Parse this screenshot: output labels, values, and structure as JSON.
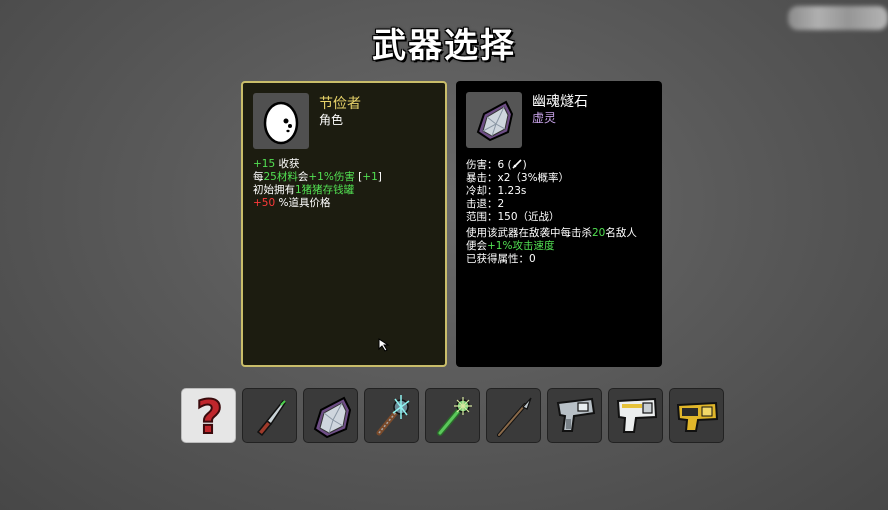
{
  "title": "武器选择",
  "character": {
    "name": "节俭者",
    "type": "角色",
    "icon": "egg-character-icon",
    "stats": {
      "l1_value": "+15",
      "l1_text": " 收获",
      "l2_a": "每",
      "l2_b": "25材料",
      "l2_c": "会",
      "l2_d": "+1%伤害",
      "l2_e": " [",
      "l2_f": "+1",
      "l2_g": "]",
      "l3_a": "初始拥有",
      "l3_b": "1猪猪存钱罐",
      "l4_value": "+50",
      "l4_text": " %道具价格"
    }
  },
  "weapon": {
    "name": "幽魂燧石",
    "type": "虚灵",
    "icon": "ghost-flint-icon",
    "stats": {
      "damage": "伤害：6 (",
      "damage_end": ")",
      "crit": "暴击：x2（3%概率）",
      "cooldown": "冷却：1.23s",
      "knockback": "击退：2",
      "range": "范围：150（近战）",
      "effect1_a": "使用该武器在敌袭中每击杀",
      "effect1_b": "20",
      "effect1_c": "名敌人",
      "effect2_a": "便会",
      "effect2_b": "+1%攻击速度",
      "obtained": "已获得属性：0"
    }
  },
  "weapon_slots": [
    {
      "icon": "random-question-icon",
      "selected": true
    },
    {
      "icon": "knife-icon",
      "selected": false
    },
    {
      "icon": "ghost-flint-icon",
      "selected": false
    },
    {
      "icon": "chain-mace-icon",
      "selected": false
    },
    {
      "icon": "spiked-club-icon",
      "selected": false
    },
    {
      "icon": "spear-icon",
      "selected": false
    },
    {
      "icon": "pistol-icon",
      "selected": false
    },
    {
      "icon": "blaster-icon",
      "selected": false
    },
    {
      "icon": "taser-icon",
      "selected": false
    }
  ],
  "colors": {
    "highlight_green": "#52e052",
    "negative_red": "#ff3a3a",
    "character_name": "#e8d36a",
    "weapon_class": "#c9a4ea",
    "selected_border": "#c9bd6a"
  }
}
